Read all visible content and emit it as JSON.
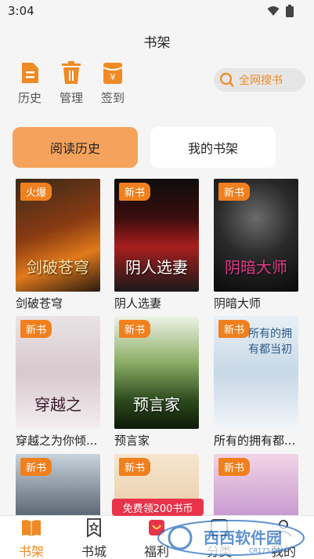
{
  "status": {
    "time": "3:04"
  },
  "header": {
    "title": "书架"
  },
  "toolbar": {
    "history_label": "历史",
    "manage_label": "管理",
    "checkin_label": "签到",
    "search_label": "全网搜书"
  },
  "tabs": [
    {
      "label": "阅读历史",
      "active": true
    },
    {
      "label": "我的书架",
      "active": false
    }
  ],
  "books": [
    {
      "name": "剑破苍穹",
      "badge": "火爆",
      "cover_text": "剑破苍穹"
    },
    {
      "name": "阴人选妻",
      "badge": "新书",
      "cover_text": "阴人选妻"
    },
    {
      "name": "阴暗大师",
      "badge": "新书",
      "cover_text": "阴暗大师"
    },
    {
      "name": "穿越之为你倾...",
      "badge": "新书",
      "cover_text": "穿越之"
    },
    {
      "name": "预言家",
      "badge": "新书",
      "cover_text": "预言家"
    },
    {
      "name": "所有的拥有都...",
      "badge": "新书",
      "cover_text": "所有的拥有都当初"
    },
    {
      "name": "",
      "badge": "新书",
      "cover_text": ""
    },
    {
      "name": "",
      "badge": "新书",
      "cover_text": ""
    },
    {
      "name": "",
      "badge": "新书",
      "cover_text": ""
    }
  ],
  "promo": {
    "label": "免费领200书币"
  },
  "bottom_nav": [
    {
      "label": "书架",
      "active": true,
      "icon": "book-open-icon"
    },
    {
      "label": "书城",
      "active": false,
      "icon": "store-icon"
    },
    {
      "label": "福利",
      "active": false,
      "icon": "gift-icon"
    },
    {
      "label": "分类",
      "active": false,
      "icon": "category-icon"
    },
    {
      "label": "我的",
      "active": false,
      "icon": "profile-icon"
    }
  ],
  "watermark": {
    "text": "西西软件园",
    "sub": "CR173.COM"
  },
  "colors": {
    "accent": "#f08a24",
    "tab_active": "#f5a35c",
    "badge": "#f0801e",
    "promo": "#e8334a"
  }
}
